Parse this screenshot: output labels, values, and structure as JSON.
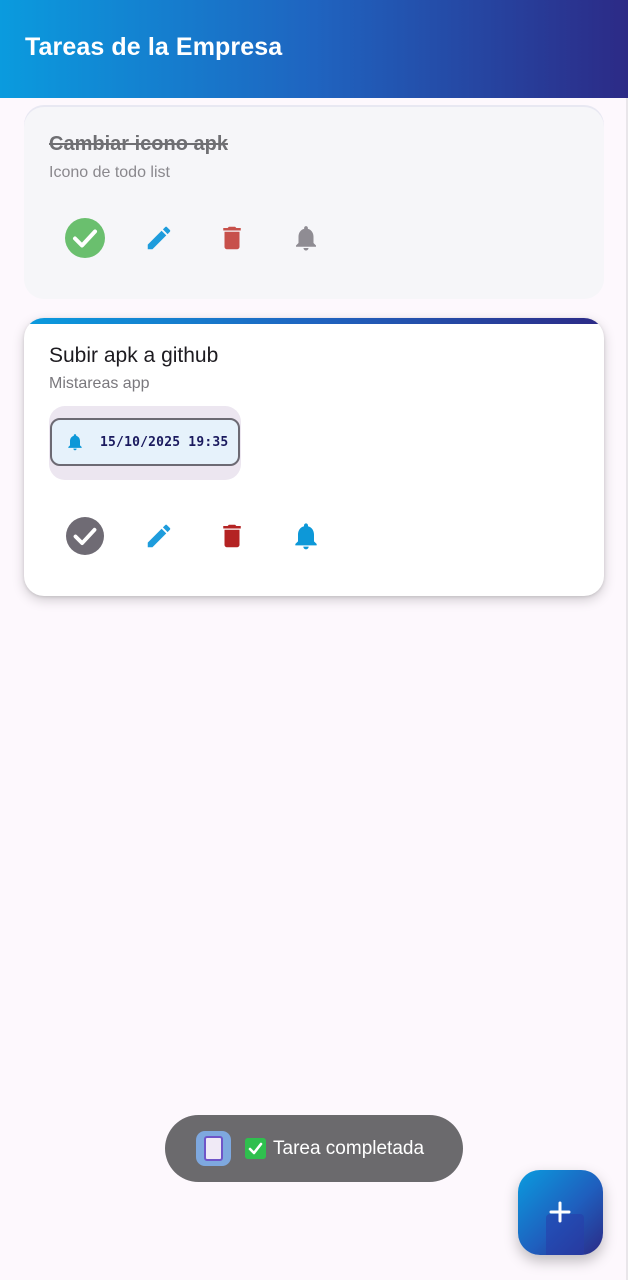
{
  "appbar": {
    "title": "Tareas de la Empresa"
  },
  "tasks": [
    {
      "title": "Cambiar icono apk",
      "description": "Icono de todo list",
      "completed": true,
      "reminder_set": false
    },
    {
      "title": "Subir apk a github",
      "description": "Mistareas app",
      "completed": false,
      "reminder_set": true,
      "reminder": "15/10/2025 19:35"
    }
  ],
  "icons": {
    "complete": "check-circle-icon",
    "edit": "pencil-icon",
    "delete": "trash-icon",
    "reminder": "bell-icon",
    "add": "plus-icon"
  },
  "colors": {
    "accent_start": "#0a9bde",
    "accent_end": "#2c2a86",
    "complete_done": "#6abf6e",
    "complete_pending": "#6f6b74",
    "edit": "#1e9cdc",
    "delete_muted": "#c7504b",
    "delete": "#b42323",
    "bell_muted": "#8f8c93",
    "bell_active": "#0d98d8"
  },
  "toast": {
    "text": "Tarea completada"
  }
}
